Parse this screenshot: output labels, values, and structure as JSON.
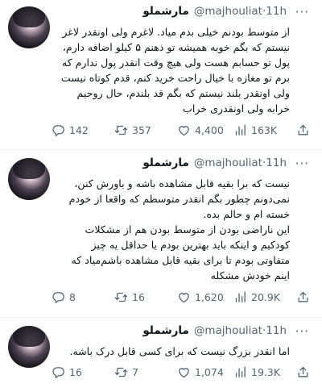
{
  "tweets": [
    {
      "display_name": "مارشملو",
      "handle": "@majhouliat",
      "separator": "·",
      "time": "11h",
      "text": "از متوسط بودنم خیلی بدم میاد. لاغرم ولی اونقدر لاغر نیستم که بگم خوبه همیشه تو ذهنم ۵ کیلو اضافه دارم، پول تو حسابم هست ولی هیچ وقت انقدر پول ندارم که برم تو مغازه با خیال راحت خرید کنم، قدم کوتاه نیست ولی اونقدر بلند نیستم که بگم قد بلندم، حال روحیم خرابه ولی اونقدری خراب",
      "replies": "142",
      "retweets": "357",
      "likes": "4,400",
      "views": "163K"
    },
    {
      "display_name": "مارشملو",
      "handle": "@majhouliat",
      "separator": "·",
      "time": "11h",
      "text_p1": "نیست که برا بقیه قابل مشاهده باشه و باورش کنن، نمی‌دونم چطور بگم انقدر متوسطم که واقعا از خودم خسته ام و حالم بده.",
      "text_p2": "این ناراضی بودن از متوسط بودن هم از مشکلات کودکیم و اینکه باید بهترین بودم یا حداقل یه چیز متفاوتی بودم تا برای بقیه  قابل مشاهده باشم‌میاد که اینم خودش مشکله",
      "replies": "8",
      "retweets": "16",
      "likes": "1,620",
      "views": "20.9K"
    },
    {
      "display_name": "مارشملو",
      "handle": "@majhouliat",
      "separator": "·",
      "time": "11h",
      "text": "اما انقدر بزرگ نیست که برای کسی قابل درک باشه.",
      "replies": "16",
      "retweets": "7",
      "likes": "1,074",
      "views": "19.3K"
    }
  ],
  "icons": {
    "more": "more-icon",
    "reply": "reply-icon",
    "retweet": "retweet-icon",
    "like": "heart-icon",
    "views": "views-icon",
    "share": "share-icon"
  },
  "colors": {
    "text": "#0f1419",
    "secondary": "#536471",
    "divider": "#eff3f4"
  }
}
